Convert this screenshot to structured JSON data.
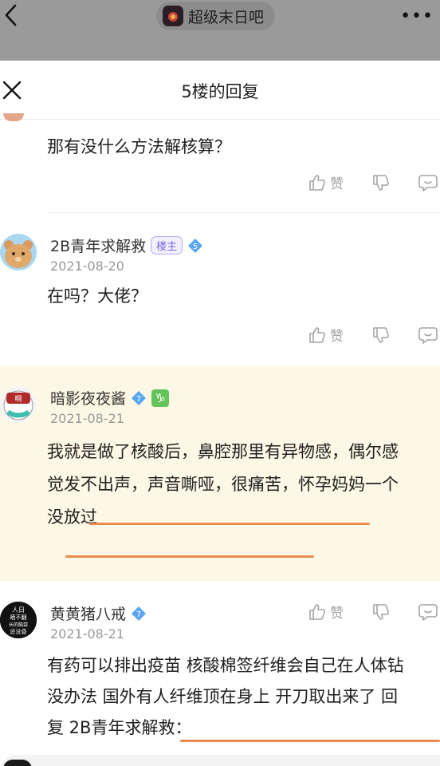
{
  "topbar": {
    "forum_name": "超级末日吧",
    "more": "•••"
  },
  "sheet": {
    "title": "5楼的回复"
  },
  "replies": [
    {
      "text": "那有没什么方法解核算？",
      "like": "赞"
    },
    {
      "user": "2B青年求解救",
      "badge": "楼主",
      "level": "5",
      "date": "2021-08-20",
      "text": "在吗？大佬？",
      "like": "赞"
    },
    {
      "user": "暗影夜夜酱",
      "level": "7",
      "zodiac": "♑",
      "date": "2021-08-21",
      "lines": [
        "我就是做了核酸后，鼻腔那里有异物感，偶尔感",
        "觉发不出声，声音嘶哑，很痛苦，怀孕妈妈一个",
        "没放过"
      ],
      "like": "赞"
    },
    {
      "user": "黄黄猪八戒",
      "level": "7",
      "date": "2021-08-21",
      "avatar_text": "人日\n晒不翻\n长的脑袋\n还没昏",
      "lines": [
        "有药可以排出疫苗 核酸棉签纤维会自己在人体钻",
        "没办法 国外有人纤维顶在身上 开刀取出来了 回",
        "复 2B青年求解救："
      ]
    }
  ],
  "colors": {
    "highlight_bg": "#fdf8e6",
    "underline": "#e98a4e",
    "host_badge": "#7a6ad8",
    "gem": "#5aa6f4"
  },
  "icons": [
    "back-icon",
    "forum-logo-icon",
    "more-icon",
    "close-icon",
    "thumb-up-icon",
    "thumb-down-icon",
    "comment-icon",
    "diamond-level-icon",
    "capricorn-icon"
  ]
}
